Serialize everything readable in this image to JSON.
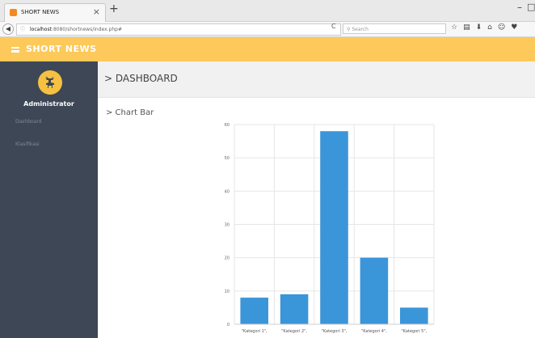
{
  "browser": {
    "tab_title": "SHORT NEWS",
    "tab_close": "×",
    "new_tab": "+",
    "url_host": "localhost",
    "url_path": ":8080/shortnews/index.php#",
    "search_placeholder": "Search",
    "reload_icon": "C",
    "window_min": "–",
    "window_max": "□"
  },
  "app": {
    "brand": "SHORT NEWS",
    "accent_color": "#fcc95a",
    "sidebar_color": "#3e4756"
  },
  "sidebar": {
    "user_name": "Administrator",
    "items": [
      {
        "label": "Dashboard"
      },
      {
        "label": "Klasifikasi"
      }
    ]
  },
  "main": {
    "page_title": "> DASHBOARD",
    "panel_title": "> Chart Bar"
  },
  "chart_data": {
    "type": "bar",
    "categories": [
      "\"Kategori 1\",",
      "\"Kategori 2\",",
      "\"Kategori 3\",",
      "\"Kategori 4\",",
      "\"Kategori 5\","
    ],
    "values": [
      8,
      9,
      58,
      20,
      5
    ],
    "ylim": [
      0,
      60
    ],
    "yticks": [
      0,
      10,
      20,
      30,
      40,
      50,
      60
    ],
    "grid": true,
    "color": "#3b95d9"
  }
}
